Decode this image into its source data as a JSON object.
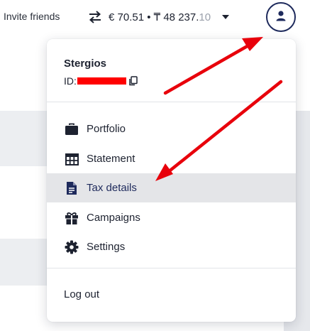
{
  "header": {
    "invite_label": "Invite friends",
    "balance_main": "€ 70.51 • ₸ 48 237.",
    "balance_dim": "10",
    "swap_icon": "swap-arrows-icon",
    "avatar_icon": "user-icon"
  },
  "menu": {
    "user_name": "Stergios",
    "id_label": "ID:",
    "items": [
      {
        "label": "Portfolio",
        "icon": "briefcase-icon"
      },
      {
        "label": "Statement",
        "icon": "table-icon"
      },
      {
        "label": "Tax details",
        "icon": "document-icon",
        "active": true
      },
      {
        "label": "Campaigns",
        "icon": "gift-icon"
      },
      {
        "label": "Settings",
        "icon": "gear-icon"
      }
    ],
    "logout_label": "Log out"
  },
  "colors": {
    "accent_navy": "#1e2a5c",
    "annotation_red": "#e8000b",
    "redaction_red": "#ff0000",
    "active_row_bg": "#e4e5e8"
  }
}
